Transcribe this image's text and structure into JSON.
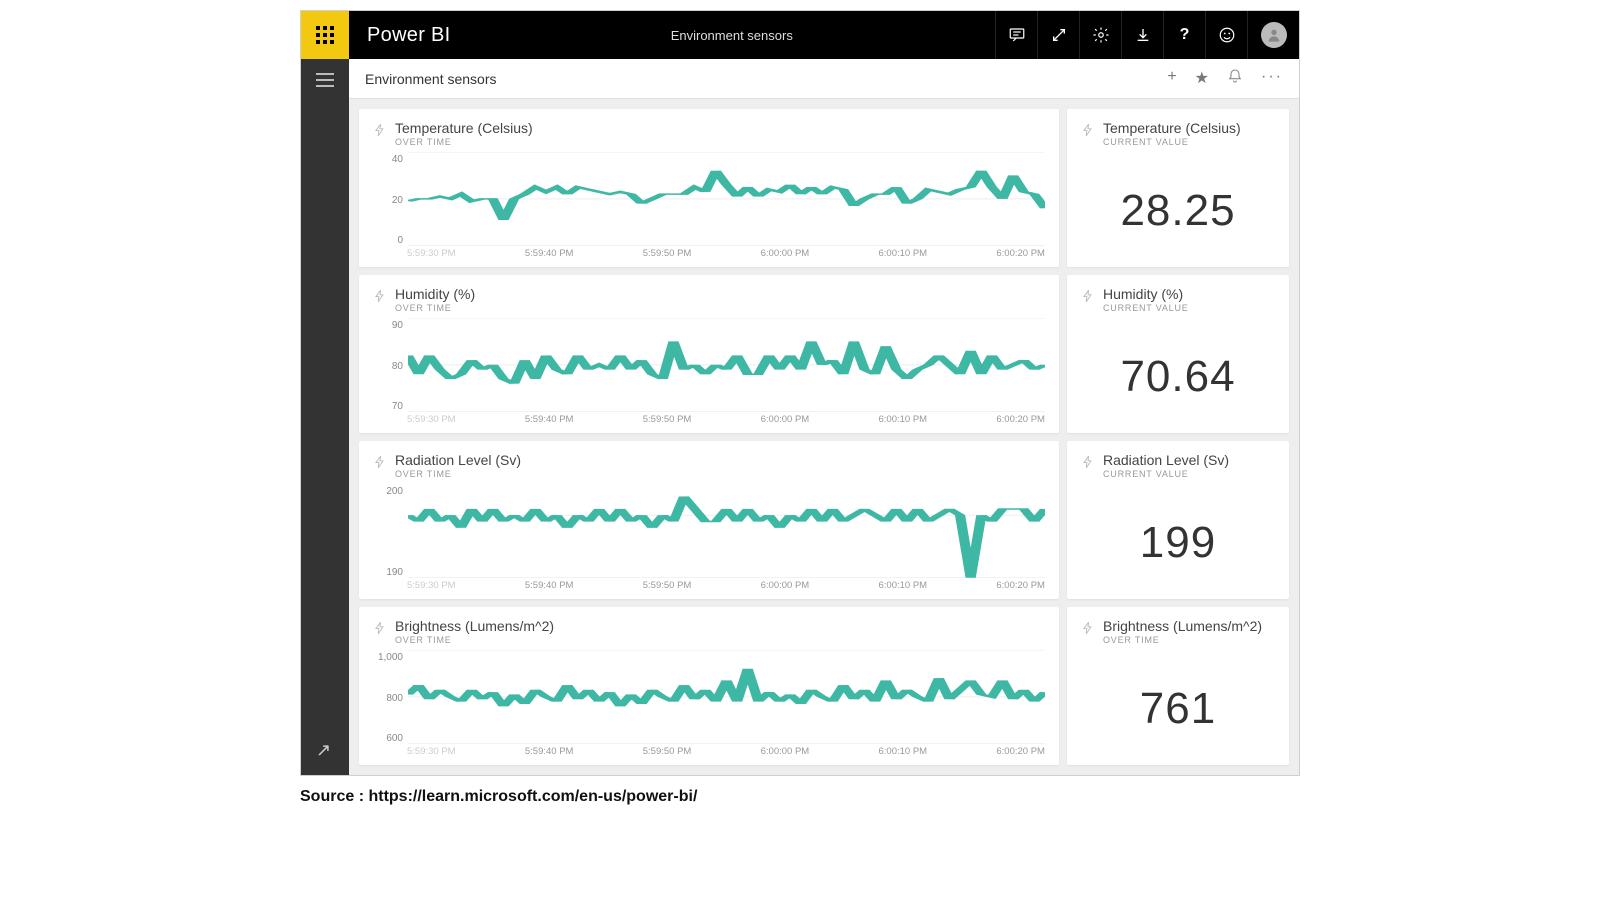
{
  "header": {
    "brand": "Power BI",
    "doc_title": "Environment sensors"
  },
  "breadcrumb": {
    "title": "Environment sensors"
  },
  "x_ticks": [
    "5:59:30 PM",
    "5:59:40 PM",
    "5:59:50 PM",
    "6:00:00 PM",
    "6:00:10 PM",
    "6:00:20 PM"
  ],
  "tiles": [
    {
      "id": "temperature",
      "title": "Temperature (Celsius)",
      "subtitle_chart": "OVER TIME",
      "subtitle_kpi": "CURRENT VALUE",
      "kpi": "28.25",
      "y_ticks": [
        "40",
        "20",
        "0"
      ]
    },
    {
      "id": "humidity",
      "title": "Humidity (%)",
      "subtitle_chart": "OVER TIME",
      "subtitle_kpi": "CURRENT VALUE",
      "kpi": "70.64",
      "y_ticks": [
        "90",
        "80",
        "70"
      ]
    },
    {
      "id": "radiation",
      "title": "Radiation Level (Sv)",
      "subtitle_chart": "OVER TIME",
      "subtitle_kpi": "CURRENT VALUE",
      "kpi": "199",
      "y_ticks": [
        "200",
        "190"
      ]
    },
    {
      "id": "brightness",
      "title": "Brightness (Lumens/m^2)",
      "subtitle_chart": "OVER TIME",
      "subtitle_kpi": "OVER TIME",
      "kpi": "761",
      "y_ticks": [
        "1,000",
        "800",
        "600"
      ]
    }
  ],
  "chart_data": [
    {
      "type": "line",
      "id": "temperature",
      "title": "Temperature (Celsius) OVER TIME",
      "xlabel": "",
      "ylabel": "",
      "ylim": [
        0,
        40
      ],
      "x": [
        "5:59:30 PM",
        "5:59:40 PM",
        "5:59:50 PM",
        "6:00:00 PM",
        "6:00:10 PM",
        "6:00:20 PM"
      ],
      "series": [
        {
          "name": "Temperature",
          "values": [
            19,
            20,
            20,
            21,
            20,
            22,
            19,
            20,
            20,
            11,
            20,
            22,
            25,
            23,
            25,
            22,
            25,
            24,
            23,
            22,
            23,
            22,
            18,
            20,
            22,
            22,
            22,
            25,
            23,
            32,
            26,
            21,
            25,
            21,
            24,
            23,
            26,
            22,
            25,
            22,
            25,
            24,
            17,
            20,
            22,
            22,
            25,
            18,
            20,
            24,
            23,
            22,
            24,
            25,
            32,
            25,
            20,
            30,
            23,
            22,
            16
          ]
        }
      ]
    },
    {
      "type": "line",
      "id": "humidity",
      "title": "Humidity (%) OVER TIME",
      "xlabel": "",
      "ylabel": "",
      "ylim": [
        70,
        90
      ],
      "x": [
        "5:59:30 PM",
        "5:59:40 PM",
        "5:59:50 PM",
        "6:00:00 PM",
        "6:00:10 PM",
        "6:00:20 PM"
      ],
      "series": [
        {
          "name": "Humidity",
          "values": [
            82,
            78,
            82,
            79,
            77,
            78,
            81,
            79,
            80,
            77,
            76,
            81,
            77,
            82,
            79,
            78,
            82,
            79,
            80,
            79,
            82,
            79,
            81,
            78,
            77,
            85,
            79,
            80,
            78,
            80,
            79,
            82,
            78,
            78,
            82,
            79,
            82,
            79,
            85,
            80,
            81,
            78,
            85,
            79,
            78,
            84,
            79,
            77,
            79,
            80,
            82,
            80,
            78,
            83,
            78,
            82,
            79,
            80,
            81,
            79,
            80
          ]
        }
      ]
    },
    {
      "type": "line",
      "id": "radiation",
      "title": "Radiation Level (Sv) OVER TIME",
      "xlabel": "",
      "ylabel": "",
      "ylim": [
        190,
        205
      ],
      "x": [
        "5:59:30 PM",
        "5:59:40 PM",
        "5:59:50 PM",
        "6:00:00 PM",
        "6:00:10 PM",
        "6:00:20 PM"
      ],
      "series": [
        {
          "name": "Radiation",
          "values": [
            200,
            199,
            201,
            199,
            200,
            198,
            201,
            199,
            201,
            199,
            200,
            199,
            201,
            199,
            200,
            198,
            200,
            199,
            201,
            199,
            201,
            199,
            200,
            198,
            200,
            199,
            203,
            201,
            199,
            199,
            201,
            199,
            201,
            199,
            200,
            198,
            200,
            199,
            201,
            199,
            201,
            199,
            200,
            201,
            200,
            199,
            201,
            199,
            201,
            199,
            200,
            201,
            200,
            190,
            200,
            199,
            201,
            201,
            201,
            199,
            201
          ]
        }
      ]
    },
    {
      "type": "line",
      "id": "brightness",
      "title": "Brightness (Lumens/m^2) OVER TIME",
      "xlabel": "",
      "ylabel": "",
      "ylim": [
        600,
        1000
      ],
      "x": [
        "5:59:30 PM",
        "5:59:40 PM",
        "5:59:50 PM",
        "6:00:00 PM",
        "6:00:10 PM",
        "6:00:20 PM"
      ],
      "series": [
        {
          "name": "Brightness",
          "values": [
            810,
            850,
            790,
            830,
            800,
            780,
            830,
            790,
            820,
            760,
            810,
            770,
            830,
            800,
            780,
            850,
            790,
            830,
            780,
            820,
            760,
            810,
            770,
            830,
            800,
            780,
            850,
            790,
            830,
            780,
            870,
            780,
            920,
            780,
            820,
            780,
            810,
            770,
            830,
            800,
            780,
            850,
            790,
            830,
            780,
            870,
            790,
            830,
            800,
            780,
            880,
            790,
            830,
            870,
            810,
            800,
            870,
            790,
            830,
            780,
            820
          ]
        }
      ]
    }
  ],
  "source": {
    "label": "Source : ",
    "url_text": "https://learn.microsoft.com/en-us/power-bi/"
  }
}
